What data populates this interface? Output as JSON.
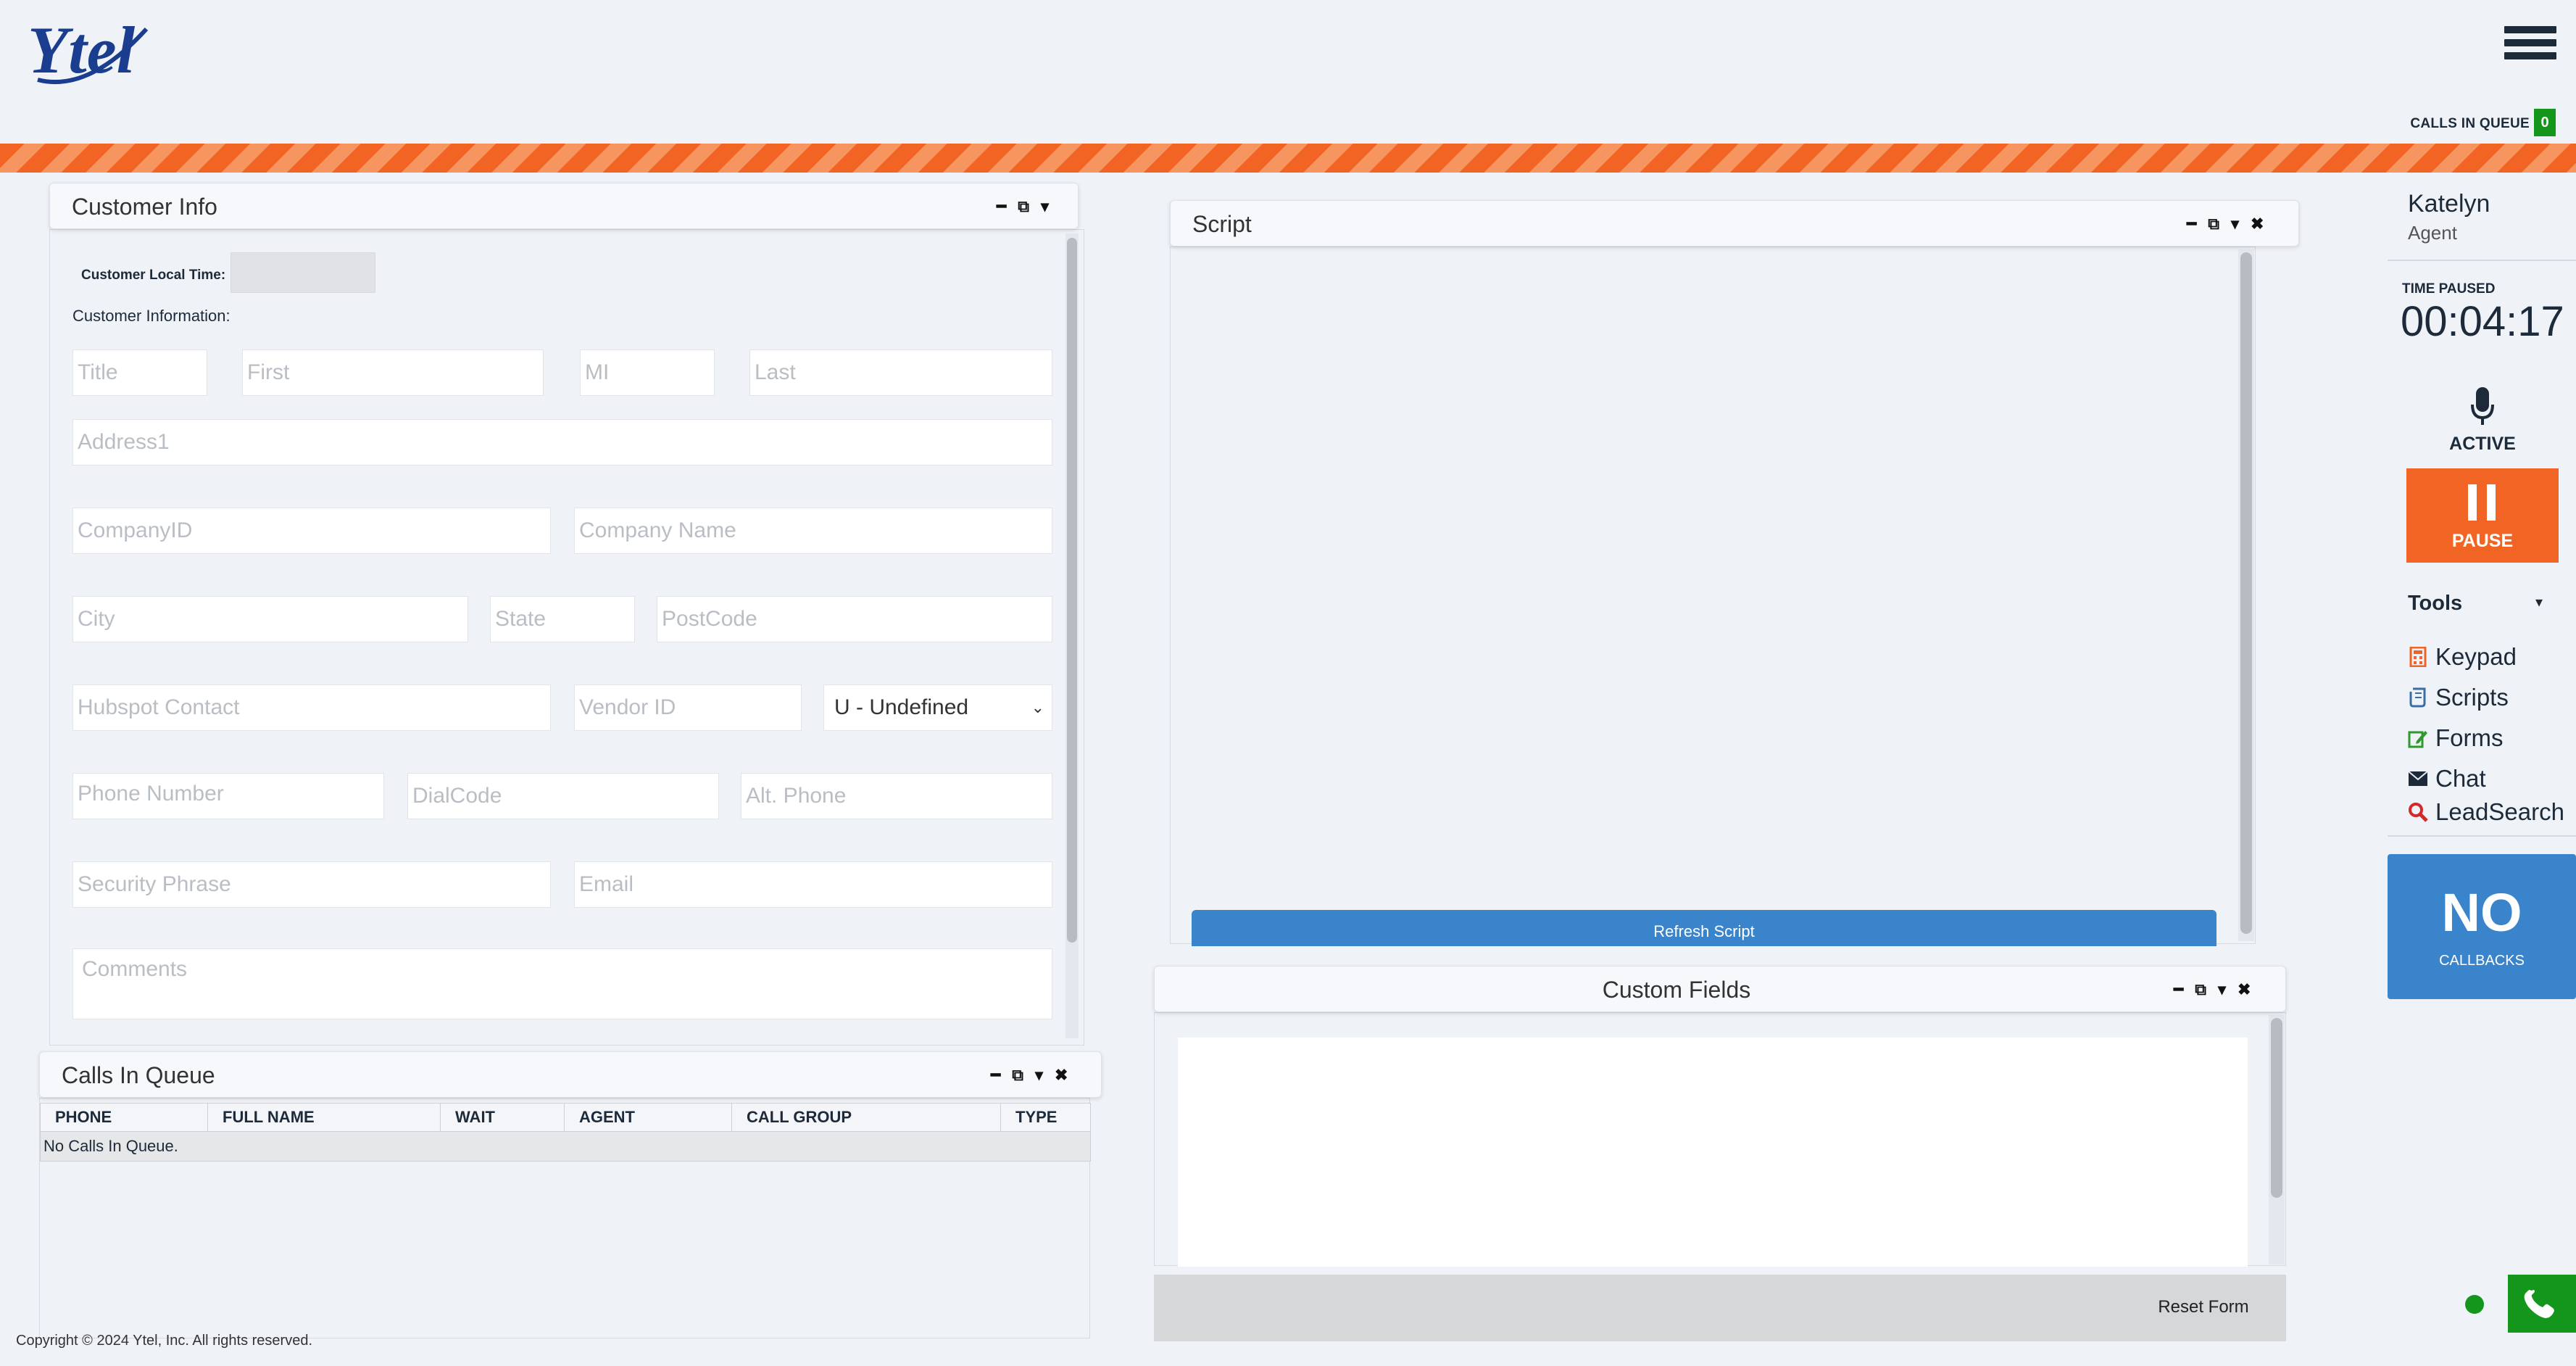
{
  "app": {
    "logo_text": "Ytel"
  },
  "header": {
    "calls_in_queue_label": "CALLS IN QUEUE",
    "calls_in_queue_count": "0",
    "menu_icon": "hamburger-menu-icon"
  },
  "customer_info": {
    "title": "Customer Info",
    "local_time_label": "Customer Local Time:",
    "local_time_value": "",
    "info_label": "Customer Information:",
    "fields": {
      "title": "Title",
      "first": "First",
      "mi": "MI",
      "last": "Last",
      "address1": "Address1",
      "company_id": "CompanyID",
      "company_name": "Company Name",
      "city": "City",
      "state": "State",
      "postcode": "PostCode",
      "hubspot_contact": "Hubspot Contact",
      "vendor_id": "Vendor ID",
      "gender_selected": "U - Undefined",
      "phone_number": "Phone Number",
      "dial_code": "DialCode",
      "alt_phone": "Alt. Phone",
      "security_phrase": "Security Phrase",
      "email": "Email",
      "comments": "Comments"
    }
  },
  "calls_queue": {
    "title": "Calls In Queue",
    "columns": [
      "PHONE",
      "FULL NAME",
      "WAIT",
      "AGENT",
      "CALL GROUP",
      "TYPE"
    ],
    "empty_text": "No Calls In Queue."
  },
  "script": {
    "title": "Script",
    "refresh_label": "Refresh Script"
  },
  "custom_fields": {
    "title": "Custom Fields",
    "reset_label": "Reset Form"
  },
  "agent": {
    "name": "Katelyn",
    "role": "Agent",
    "time_paused_label": "TIME PAUSED",
    "time_paused_value": "00:04:17",
    "mic_status": "ACTIVE",
    "pause_label": "PAUSE"
  },
  "tools": {
    "label": "Tools",
    "items": [
      {
        "label": "Keypad",
        "icon": "calculator-icon",
        "color": "#f26423"
      },
      {
        "label": "Scripts",
        "icon": "scroll-icon",
        "color": "#3a6ea5"
      },
      {
        "label": "Forms",
        "icon": "edit-icon",
        "color": "#2e9a2e"
      },
      {
        "label": "Chat",
        "icon": "envelope-icon",
        "color": "#1d2a3a"
      },
      {
        "label": "LeadSearch",
        "icon": "search-icon",
        "color": "#d62828"
      }
    ]
  },
  "callbacks": {
    "big": "NO",
    "small": "CALLBACKS"
  },
  "footer": {
    "copyright": "Copyright © 2024 Ytel, Inc.   All rights reserved."
  },
  "colors": {
    "accent_orange": "#f26423",
    "brand_blue": "#1a3d8f",
    "button_blue": "#3a84cb",
    "status_green": "#13961b"
  }
}
